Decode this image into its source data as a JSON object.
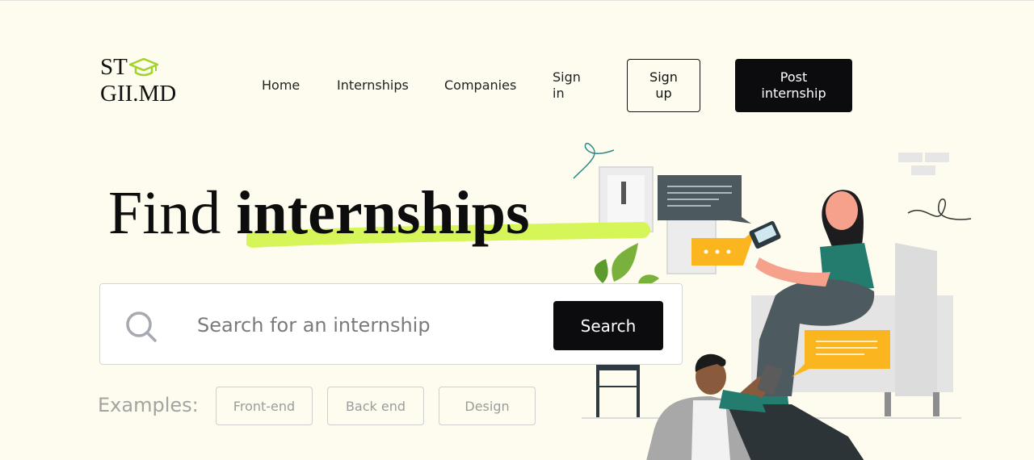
{
  "brand": {
    "line1": "ST",
    "line2": "GII.MD",
    "accent": "#9fd42a"
  },
  "nav": {
    "home": "Home",
    "internships": "Internships",
    "companies": "Companies",
    "sign_in": "Sign in",
    "sign_up": "Sign up",
    "post_internship": "Post internship"
  },
  "hero": {
    "title_plain": "Find",
    "title_bold": "internships",
    "highlight_color": "#d6f558"
  },
  "search": {
    "placeholder": "Search for an internship",
    "button": "Search"
  },
  "examples": {
    "label": "Examples:",
    "chips": [
      "Front-end",
      "Back end",
      "Design"
    ]
  },
  "colors": {
    "background": "#fdfcee",
    "primary_dark": "#0c0c0e",
    "speech_yellow": "#fbb51f",
    "speech_gray": "#4c5a60",
    "shirt_teal": "#247c6e"
  },
  "icons": [
    "graduation-cap-icon",
    "search-icon"
  ]
}
